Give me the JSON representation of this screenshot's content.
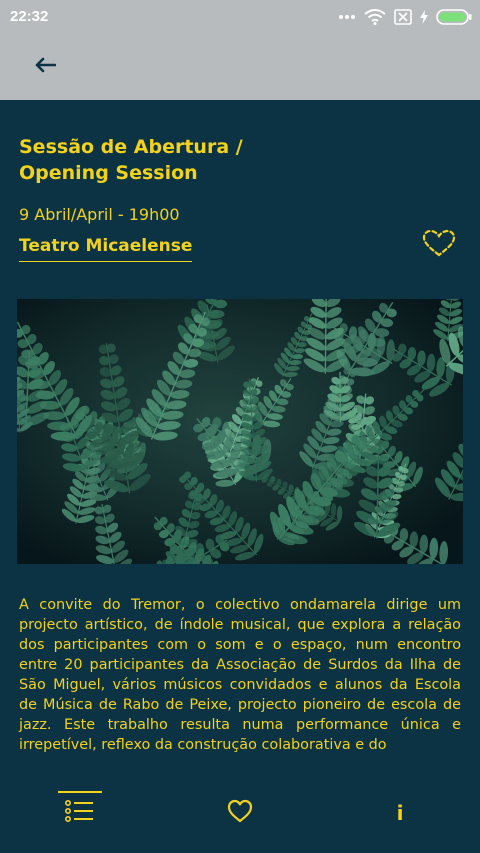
{
  "status_bar": {
    "time": "22:32",
    "icons": [
      "more-dots-icon",
      "wifi-icon",
      "no-sim-icon",
      "charging-icon",
      "battery-icon"
    ]
  },
  "app_bar": {
    "back_icon": "arrow-left-icon"
  },
  "event": {
    "title_line1": "Sessão de Abertura /",
    "title_line2": "Opening Session",
    "date": "9 Abril/April - 19h00",
    "venue": "Teatro Micaelense",
    "favorite_icon": "heart-outline-dotted-icon",
    "image_icon": "fern-leaves-photo",
    "description": "A convite do Tremor, o colectivo ondamarela dirige um projecto artístico, de índole musical, que explora a relação dos participantes com o som e o espaço, num encontro entre 20 participantes da Associação de Surdos da Ilha de São Miguel, vários músicos convidados e alunos da Escola de Música de Rabo de Peixe, projecto pioneiro de escola de jazz. Este trabalho resulta numa performance única e irrepetível, reflexo da construção colaborativa e do"
  },
  "bottom_nav": {
    "items": [
      {
        "icon": "list-icon",
        "active": true
      },
      {
        "icon": "heart-icon",
        "active": false
      },
      {
        "icon": "info-icon",
        "glyph": "i",
        "active": false
      }
    ]
  },
  "colors": {
    "accent": "#f2d21c",
    "background": "#0c3344",
    "app_bar": "#b7bbbd"
  }
}
